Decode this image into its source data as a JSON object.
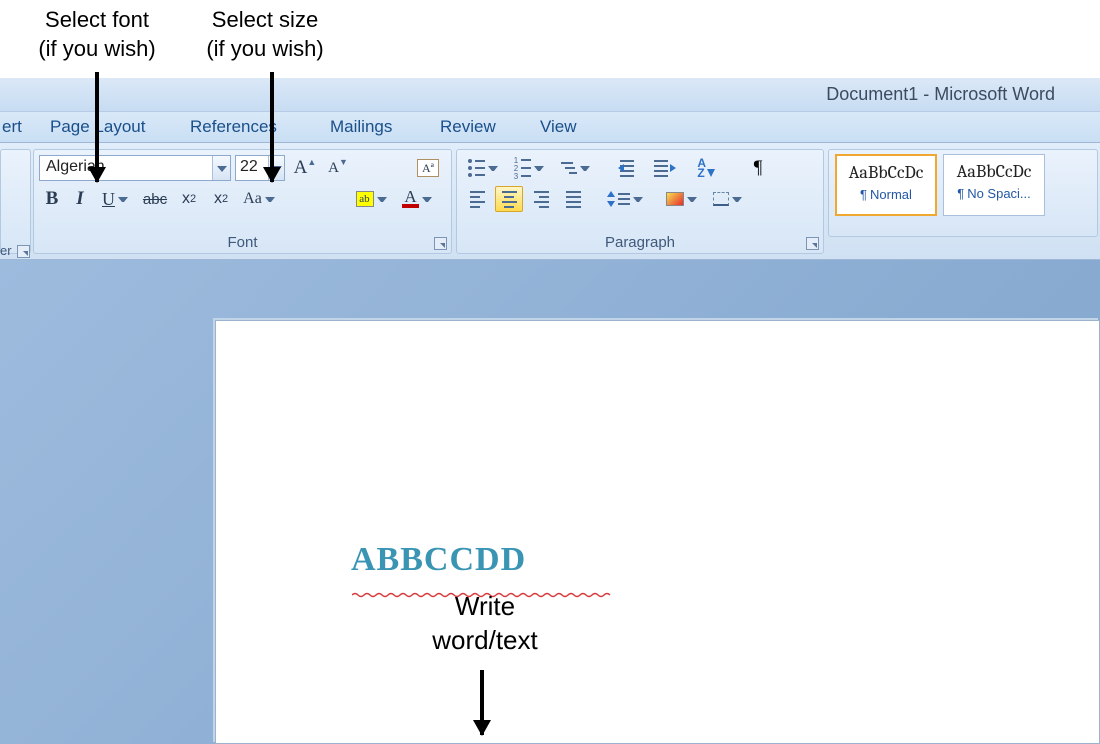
{
  "title": "Document1 - Microsoft Word",
  "tabs": {
    "insert_partial": "ert",
    "page_layout": "Page Layout",
    "references": "References",
    "mailings": "Mailings",
    "review": "Review",
    "view": "View"
  },
  "clipboard": {
    "label_partial": "er"
  },
  "font_group": {
    "label": "Font",
    "font_name": "Algerian",
    "font_size": "22",
    "bold": "B",
    "italic": "I",
    "underline": "U",
    "strike": "abc",
    "subscript_x": "x",
    "subscript_2": "2",
    "superscript_x": "x",
    "superscript_2": "2",
    "change_case": "Aa",
    "highlight_ab": "ab",
    "font_color_a": "A",
    "grow_a": "A",
    "shrink_a": "A",
    "clear_fmt": "Aª"
  },
  "para_group": {
    "label": "Paragraph",
    "pilcrow": "¶",
    "sort_a": "A",
    "sort_z": "Z"
  },
  "styles_group": {
    "sample": "AaBbCcDc",
    "normal": "Normal",
    "no_spacing": "No Spaci...",
    "pilcrow": "¶"
  },
  "document": {
    "text": "ABBCCDD"
  },
  "annotations": {
    "select_font_l1": "Select font",
    "select_font_l2": "(if you wish)",
    "select_size_l1": "Select size",
    "select_size_l2": "(if you wish)",
    "write_l1": "Write",
    "write_l2": "word/text"
  }
}
